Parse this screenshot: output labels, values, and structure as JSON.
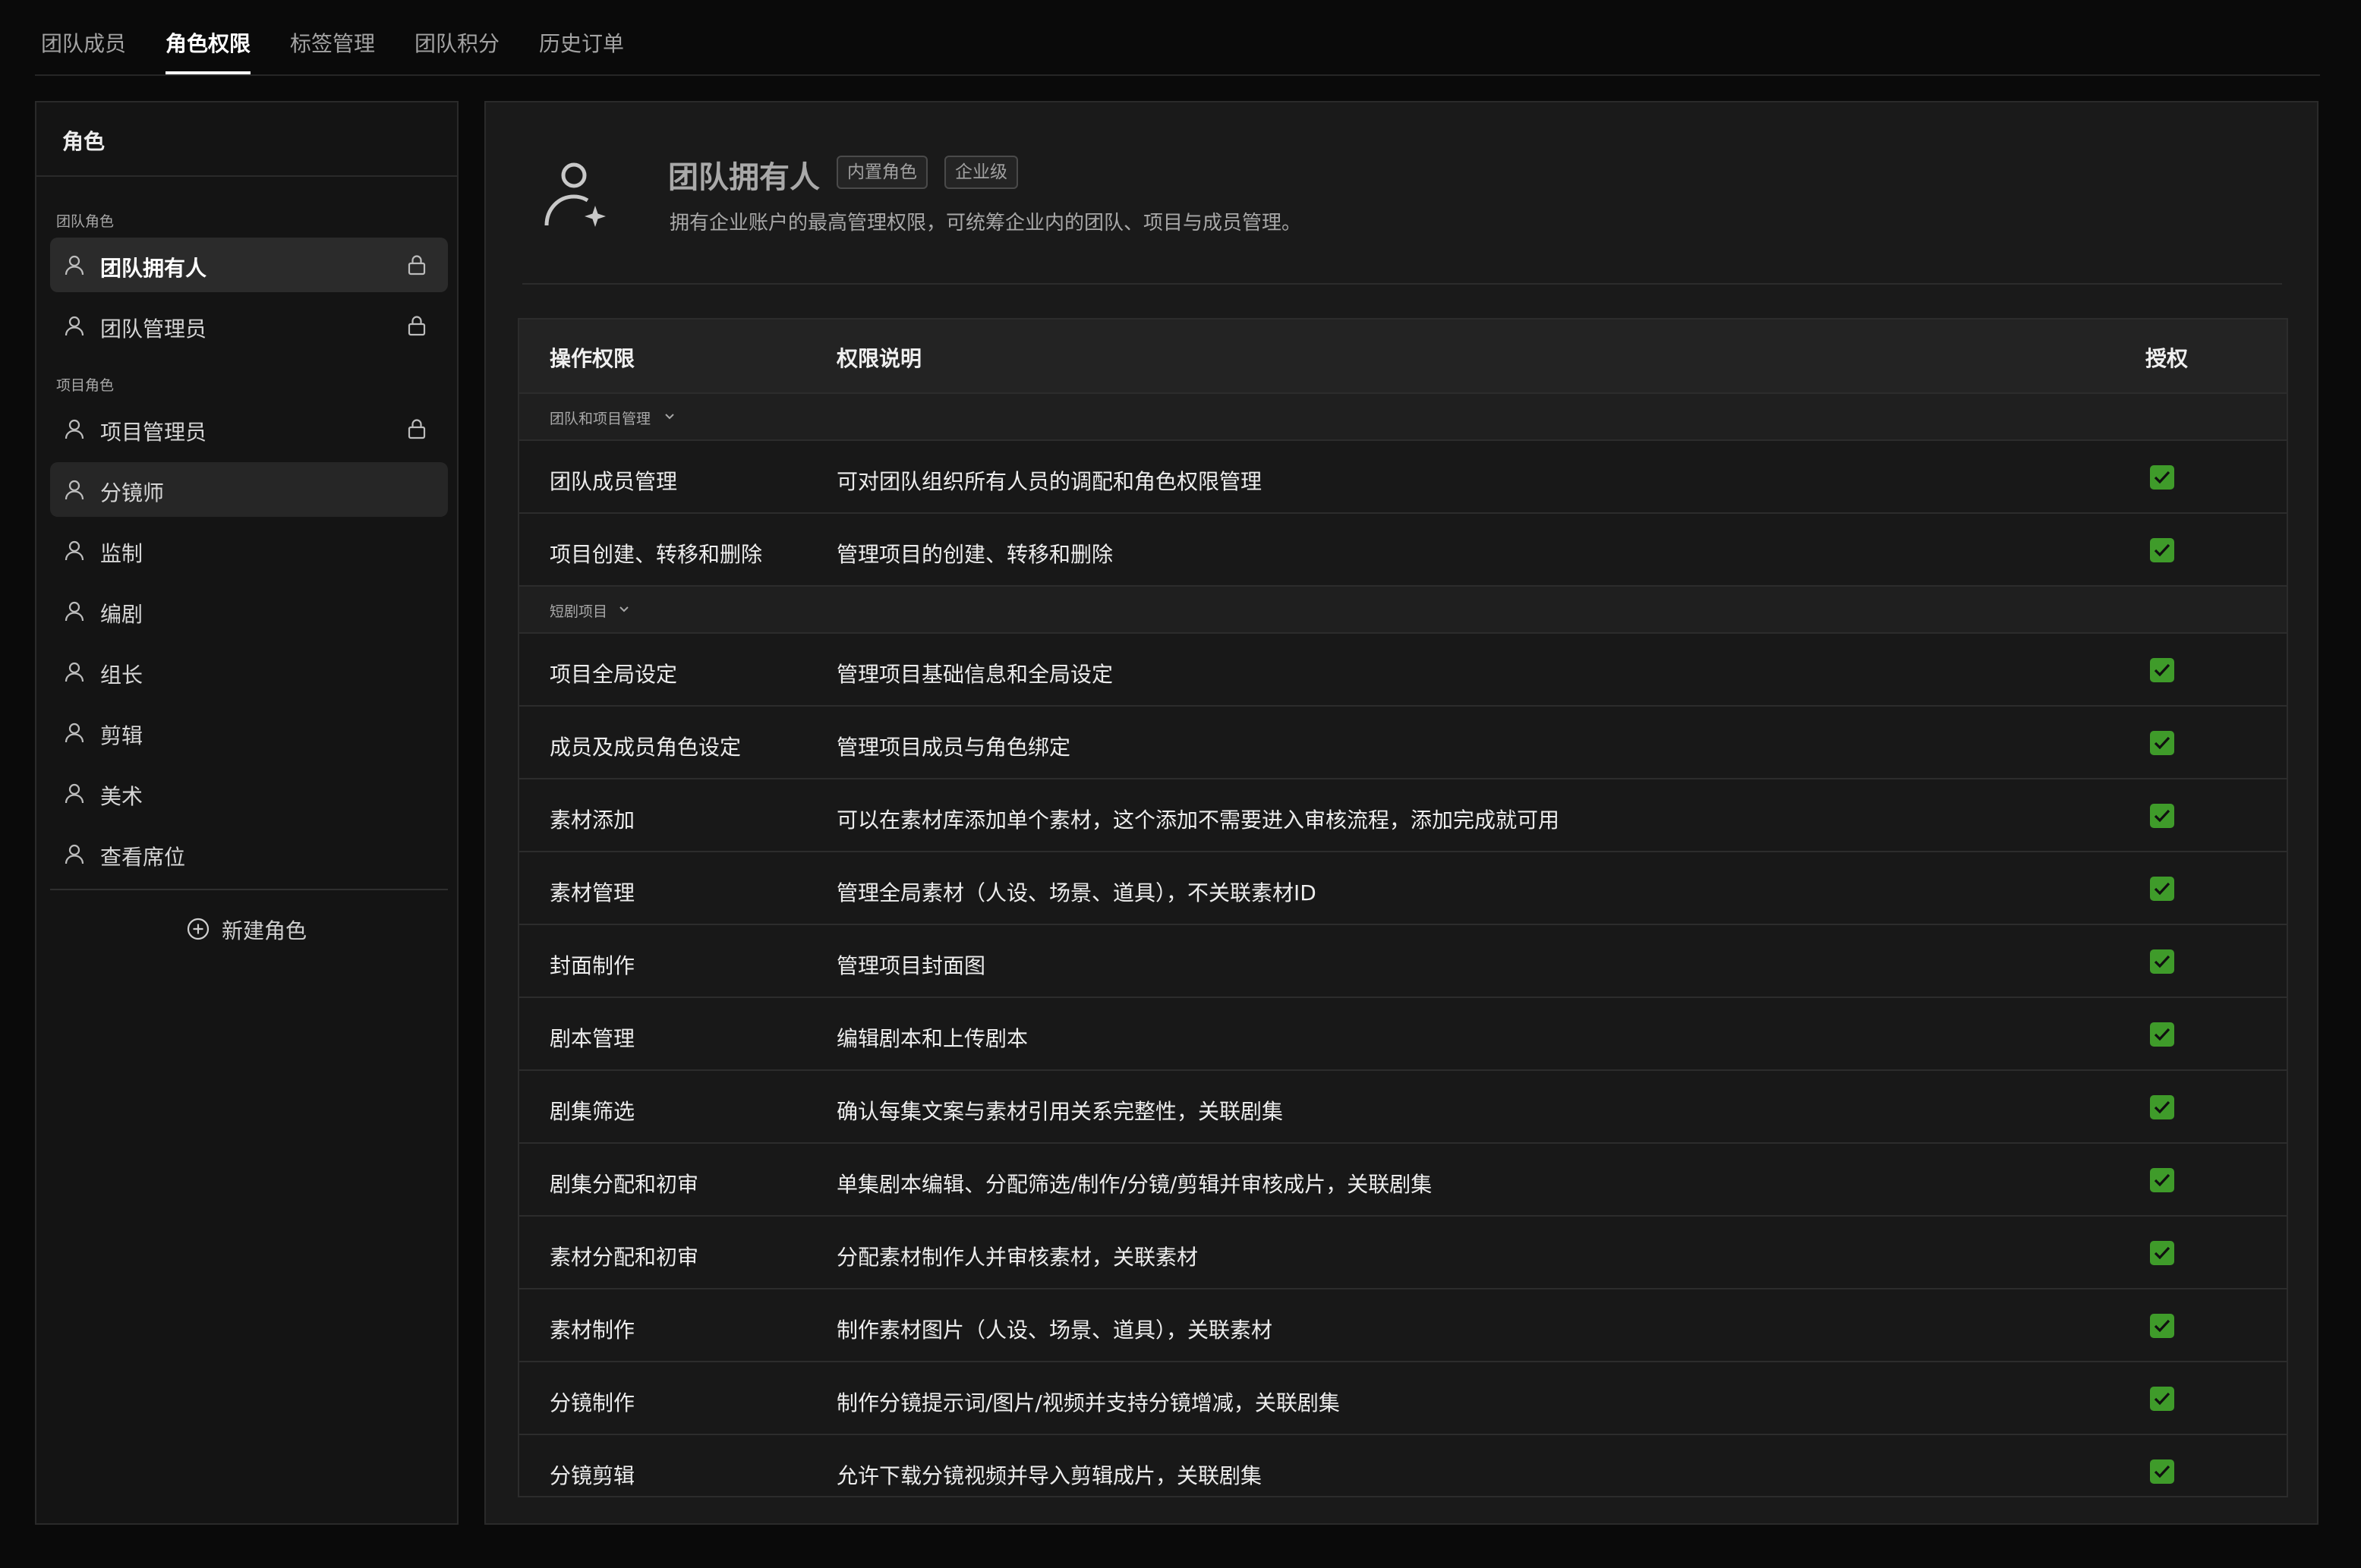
{
  "tabs": [
    {
      "label": "团队成员",
      "active": false
    },
    {
      "label": "角色权限",
      "active": true
    },
    {
      "label": "标签管理",
      "active": false
    },
    {
      "label": "团队积分",
      "active": false
    },
    {
      "label": "历史订单",
      "active": false
    }
  ],
  "sidebar": {
    "title": "角色",
    "team_roles_label": "团队角色",
    "team_roles": [
      {
        "label": "团队拥有人",
        "locked": true,
        "state": "selected"
      },
      {
        "label": "团队管理员",
        "locked": true,
        "state": "normal"
      }
    ],
    "project_roles_label": "项目角色",
    "project_roles": [
      {
        "label": "项目管理员",
        "locked": true,
        "state": "normal"
      },
      {
        "label": "分镜师",
        "locked": false,
        "state": "hover"
      },
      {
        "label": "监制",
        "locked": false,
        "state": "normal"
      },
      {
        "label": "编剧",
        "locked": false,
        "state": "normal"
      },
      {
        "label": "组长",
        "locked": false,
        "state": "normal"
      },
      {
        "label": "剪辑",
        "locked": false,
        "state": "normal"
      },
      {
        "label": "美术",
        "locked": false,
        "state": "normal"
      },
      {
        "label": "查看席位",
        "locked": false,
        "state": "normal"
      }
    ],
    "new_role_label": "新建角色"
  },
  "role_header": {
    "title": "团队拥有人",
    "badges": [
      "内置角色",
      "企业级"
    ],
    "description": "拥有企业账户的最高管理权限，可统筹企业内的团队、项目与成员管理。"
  },
  "table": {
    "columns": {
      "operation": "操作权限",
      "description": "权限说明",
      "authorized": "授权"
    },
    "groups": [
      {
        "label": "团队和项目管理",
        "rows": [
          {
            "operation": "团队成员管理",
            "description": "可对团队组织所有人员的调配和角色权限管理",
            "checked": true
          },
          {
            "operation": "项目创建、转移和删除",
            "description": "管理项目的创建、转移和删除",
            "checked": true
          }
        ]
      },
      {
        "label": "短剧项目",
        "rows": [
          {
            "operation": "项目全局设定",
            "description": "管理项目基础信息和全局设定",
            "checked": true
          },
          {
            "operation": "成员及成员角色设定",
            "description": "管理项目成员与角色绑定",
            "checked": true
          },
          {
            "operation": "素材添加",
            "description": "可以在素材库添加单个素材，这个添加不需要进入审核流程，添加完成就可用",
            "checked": true
          },
          {
            "operation": "素材管理",
            "description": "管理全局素材（人设、场景、道具），不关联素材ID",
            "checked": true
          },
          {
            "operation": "封面制作",
            "description": "管理项目封面图",
            "checked": true
          },
          {
            "operation": "剧本管理",
            "description": "编辑剧本和上传剧本",
            "checked": true
          },
          {
            "operation": "剧集筛选",
            "description": "确认每集文案与素材引用关系完整性，关联剧集",
            "checked": true
          },
          {
            "operation": "剧集分配和初审",
            "description": "单集剧本编辑、分配筛选/制作/分镜/剪辑并审核成片，关联剧集",
            "checked": true
          },
          {
            "operation": "素材分配和初审",
            "description": "分配素材制作人并审核素材，关联素材",
            "checked": true
          },
          {
            "operation": "素材制作",
            "description": "制作素材图片（人设、场景、道具），关联素材",
            "checked": true
          },
          {
            "operation": "分镜制作",
            "description": "制作分镜提示词/图片/视频并支持分镜增减，关联剧集",
            "checked": true
          },
          {
            "operation": "分镜剪辑",
            "description": "允许下载分镜视频并导入剪辑成片，关联剧集",
            "checked": true
          }
        ]
      }
    ]
  },
  "colors": {
    "background": "#0a0a0a",
    "panel": "#1a1a1a",
    "check_green": "#3f9b2a",
    "accent_text": "#ffffff"
  },
  "icons": {
    "role": "user-icon",
    "lock": "lock-icon",
    "owner": "user-star-icon",
    "group_toggle": "chevron-down-icon",
    "new_role": "plus-circle-icon",
    "check": "check-icon"
  }
}
